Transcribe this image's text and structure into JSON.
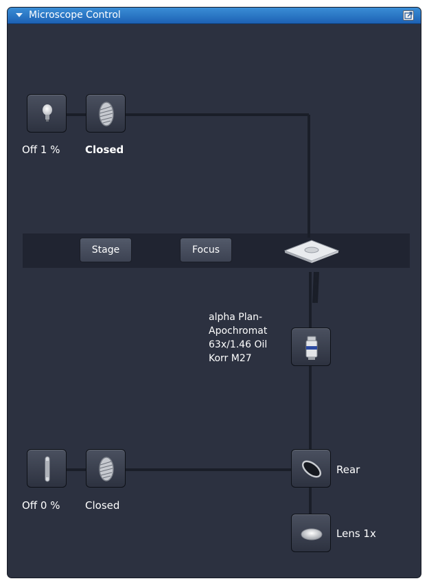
{
  "panel": {
    "title": "Microscope Control"
  },
  "transmitted_path": {
    "lamp_label": "Off 1 %",
    "shutter_label": "Closed"
  },
  "stage_band": {
    "stage_label": "Stage",
    "focus_label": "Focus"
  },
  "objective": {
    "lines": [
      "alpha  Plan-",
      "Apochromat",
      "63x/1.46 Oil",
      "Korr M27"
    ]
  },
  "reflected_path": {
    "lamp_label": "Off 0 %",
    "shutter_label": "Closed"
  },
  "reflector": {
    "label": "Rear"
  },
  "optovar": {
    "label": "Lens 1x"
  },
  "colors": {
    "panel_bg": "#2c3140",
    "titlebar": "#2a78cc",
    "stage_band": "#202431",
    "light_path": "#1a1e28"
  },
  "icons": {
    "transmitted_lamp": "light-bulb-icon",
    "transmitted_shutter": "shutter-icon",
    "stage": "stage-plate-icon",
    "objective": "objective-icon",
    "reflected_lamp": "fluorescence-lamp-icon",
    "reflected_shutter": "shutter-icon",
    "reflector": "mirror-icon",
    "optovar": "lens-icon"
  }
}
